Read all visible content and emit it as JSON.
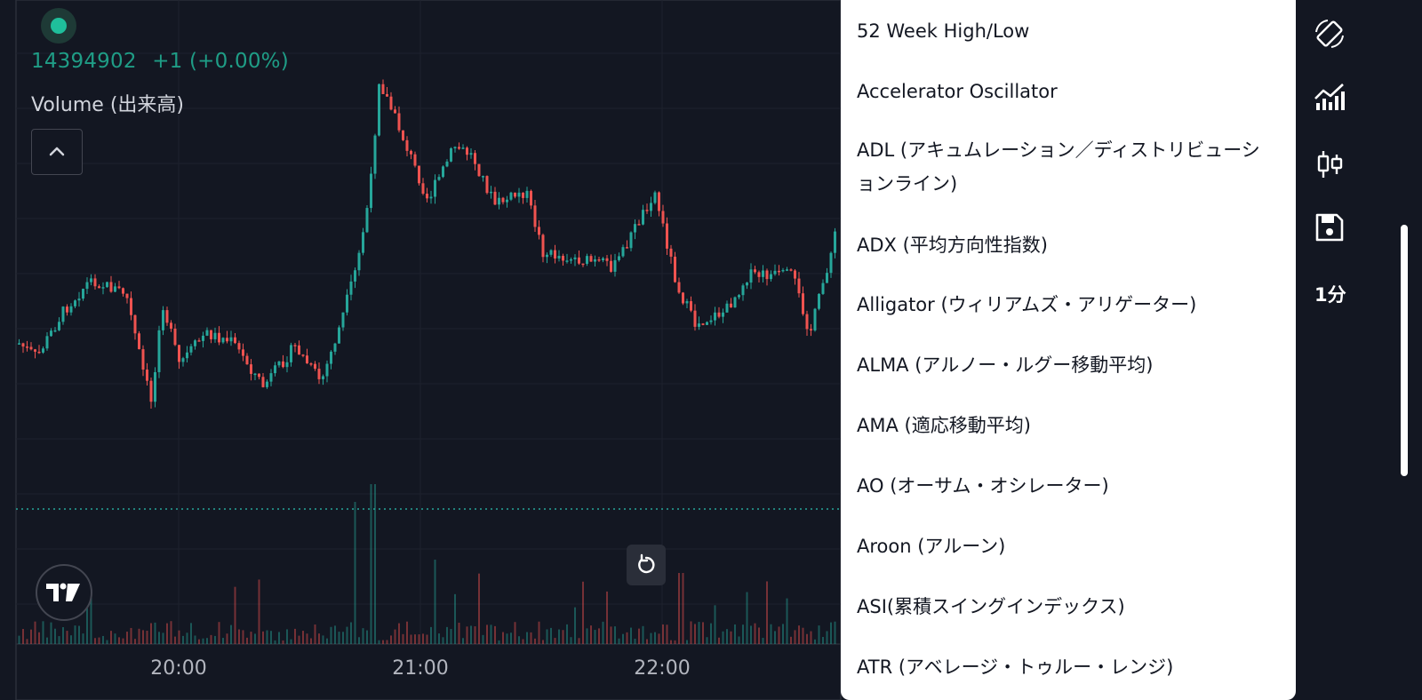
{
  "legend": {
    "volume_value": "14394902",
    "volume_change": "+1 (+0.00%)",
    "indicator_label": "Volume (出来高)",
    "status_color": "#1fbf9b"
  },
  "time_axis": {
    "labels": [
      "20:00",
      "21:00",
      "22:00"
    ]
  },
  "indicator_menu": {
    "items": [
      "52 Week High/Low",
      "Accelerator Oscillator",
      "ADL (アキュムレーション／ディストリビューションライン)",
      "ADX (平均方向性指数)",
      "Alligator (ウィリアムズ・アリゲーター)",
      "ALMA (アルノー・ルグー移動平均)",
      "AMA (適応移動平均)",
      "AO (オーサム・オシレーター)",
      "Aroon (アルーン)",
      "ASI(累積スイングインデックス)",
      "ATR (アベレージ・トゥルー・レンジ)"
    ]
  },
  "toolbar": {
    "icons": [
      "rotate-screen-icon",
      "indicators-icon",
      "candlestick-icon",
      "save-icon"
    ],
    "interval": "1分"
  },
  "colors": {
    "background": "#131722",
    "up": "#26a69a",
    "down": "#ef5350",
    "menu_bg": "#ffffff"
  }
}
